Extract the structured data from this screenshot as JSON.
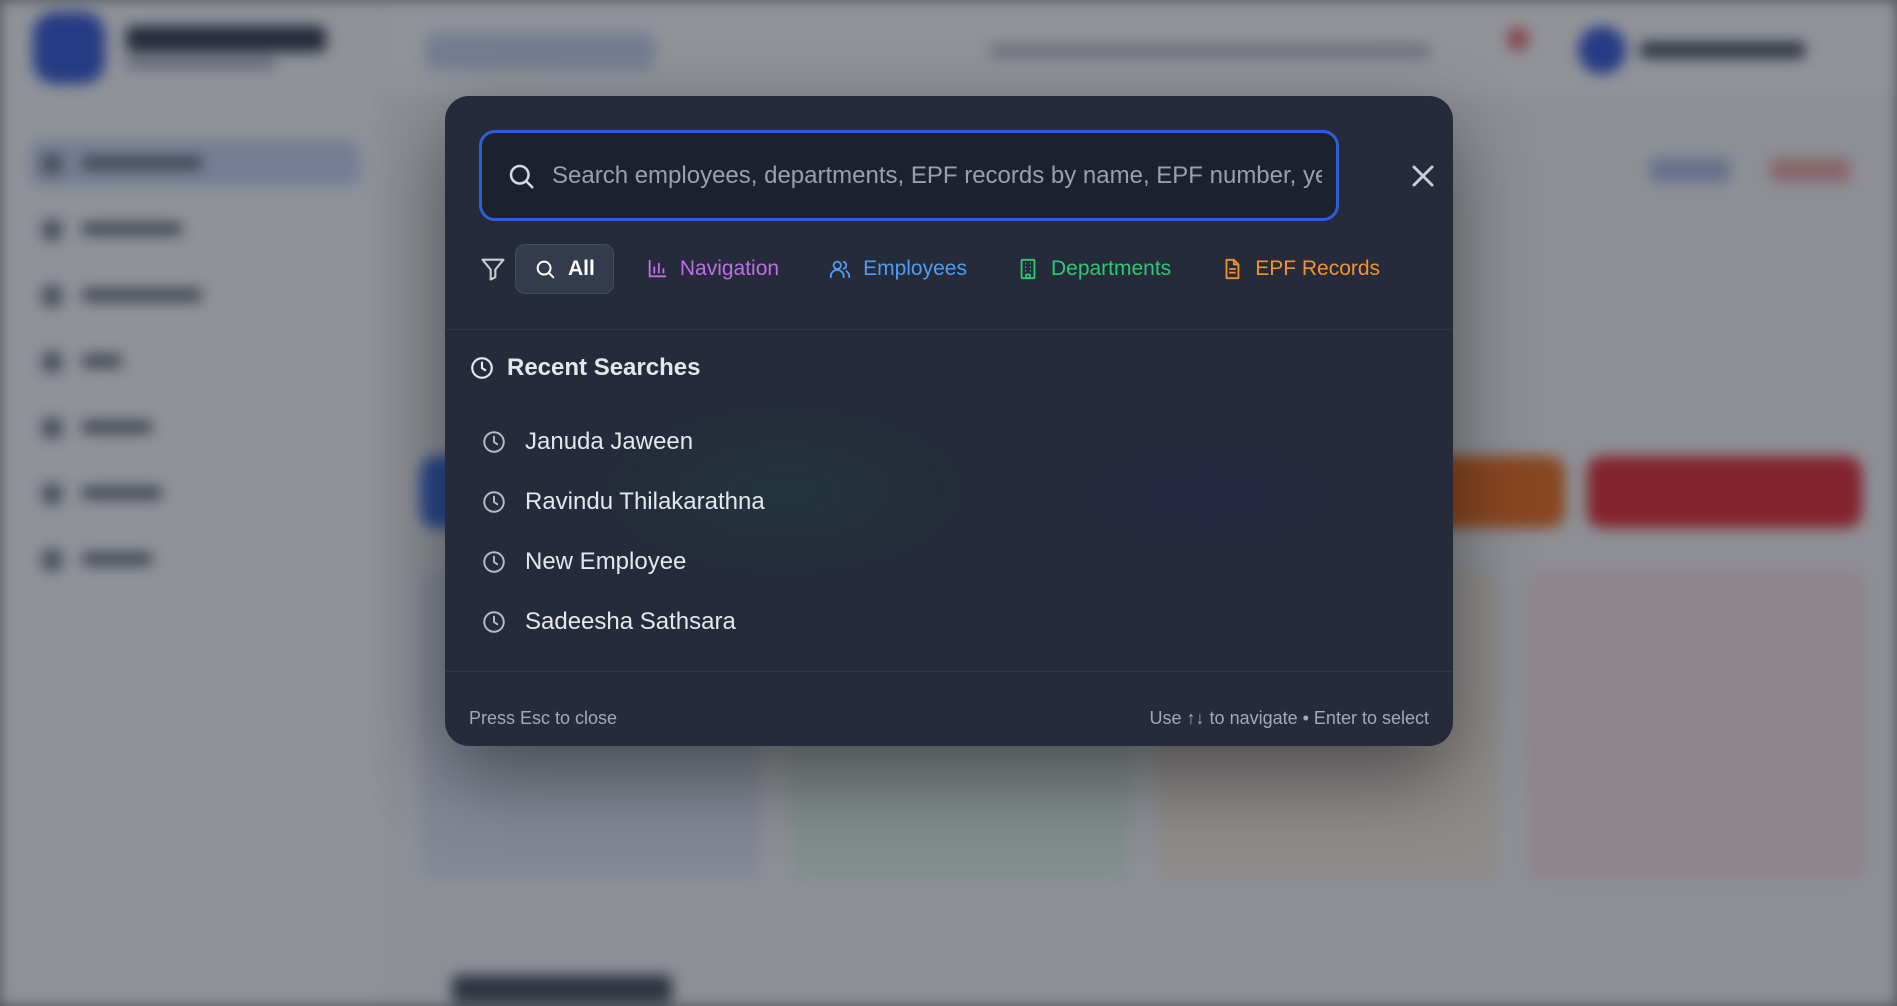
{
  "search": {
    "placeholder": "Search employees, departments, EPF records by name, EPF number, year...",
    "value": ""
  },
  "filters": [
    {
      "label": "All",
      "icon": "search-icon",
      "color": "#ffffff",
      "active": true
    },
    {
      "label": "Navigation",
      "icon": "bar-chart-icon",
      "color": "#c06ee8",
      "active": false
    },
    {
      "label": "Employees",
      "icon": "users-icon",
      "color": "#4f9cf5",
      "active": false
    },
    {
      "label": "Departments",
      "icon": "building-icon",
      "color": "#2bcb74",
      "active": false
    },
    {
      "label": "EPF Records",
      "icon": "document-icon",
      "color": "#f4922b",
      "active": false
    }
  ],
  "recent": {
    "title": "Recent Searches",
    "items": [
      {
        "label": "Januda Jaween"
      },
      {
        "label": "Ravindu Thilakarathna"
      },
      {
        "label": "New Employee"
      },
      {
        "label": "Sadeesha Sathsara"
      }
    ]
  },
  "footer": {
    "left": "Press Esc to close",
    "right": "Use ↑↓ to navigate • Enter to select"
  },
  "colors": {
    "modal_bg": "#252b3a",
    "accent": "#2c5fd6"
  }
}
